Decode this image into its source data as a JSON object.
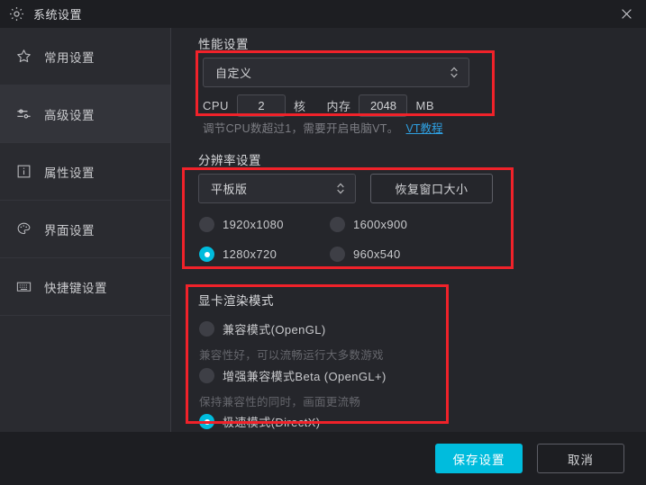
{
  "window": {
    "title": "系统设置",
    "gear_icon": "gear-icon",
    "close_icon": "close-icon"
  },
  "sidebar": {
    "items": [
      {
        "label": "常用设置",
        "icon": "star-icon",
        "active": false
      },
      {
        "label": "高级设置",
        "icon": "sliders-icon",
        "active": true
      },
      {
        "label": "属性设置",
        "icon": "info-icon",
        "active": false
      },
      {
        "label": "界面设置",
        "icon": "palette-icon",
        "active": false
      },
      {
        "label": "快捷键设置",
        "icon": "keyboard-icon",
        "active": false
      }
    ]
  },
  "performance": {
    "heading": "性能设置",
    "preset_value": "自定义",
    "cpu_label": "CPU",
    "cpu_value": "2",
    "cpu_unit": "核",
    "memory_label": "内存",
    "memory_value": "2048",
    "memory_unit": "MB",
    "hint": "调节CPU数超过1，需要开启电脑VT。",
    "hint_link": "VT教程"
  },
  "resolution": {
    "heading": "分辨率设置",
    "preset_value": "平板版",
    "restore_button": "恢复窗口大小",
    "options": [
      {
        "label": "1920x1080",
        "selected": false
      },
      {
        "label": "1600x900",
        "selected": false
      },
      {
        "label": "1280x720",
        "selected": true
      },
      {
        "label": "960x540",
        "selected": false
      }
    ]
  },
  "render": {
    "heading": "显卡渲染模式",
    "options": [
      {
        "label": "兼容模式(OpenGL)",
        "selected": false,
        "desc": "兼容性好，可以流畅运行大多数游戏"
      },
      {
        "label": "增强兼容模式Beta (OpenGL+)",
        "selected": false,
        "desc": "保持兼容性的同时，画面更流畅"
      },
      {
        "label": "极速模式(DirectX)",
        "selected": true,
        "desc": ""
      }
    ]
  },
  "footer": {
    "save_label": "保存设置",
    "cancel_label": "取消"
  },
  "colors": {
    "accent": "#00bcdd",
    "highlight_box": "#f0222a",
    "link": "#2f9fe0",
    "window_bg": "#25262b",
    "sidebar_bg": "#2a2b30",
    "titlebar_bg": "#1d1e22"
  }
}
